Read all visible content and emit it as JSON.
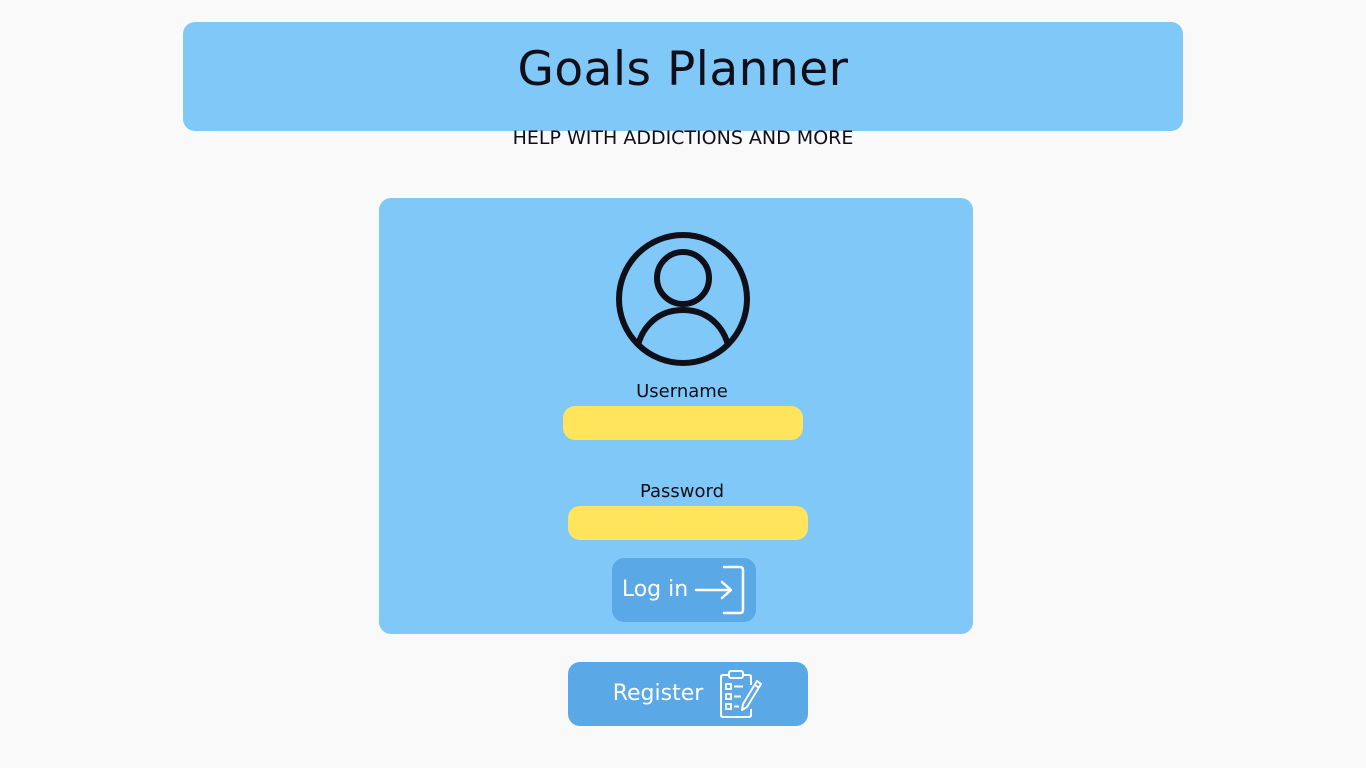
{
  "header": {
    "title": "Goals Planner",
    "subtitle": "HELP WITH ADDICTIONS AND MORE"
  },
  "login_form": {
    "avatar_icon": "user-avatar-icon",
    "username_label": "Username",
    "username_value": "",
    "password_label": "Password",
    "password_value": "",
    "login_button_label": "Log in",
    "login_icon": "login-arrow-icon"
  },
  "register": {
    "button_label": "Register",
    "icon": "clipboard-edit-icon"
  },
  "colors": {
    "background": "#f9f9f9",
    "panel": "#80c8f7",
    "button": "#5aa8e6",
    "input": "#ffe45c",
    "text_dark": "#0f0f1a",
    "text_light": "#ffffff"
  }
}
